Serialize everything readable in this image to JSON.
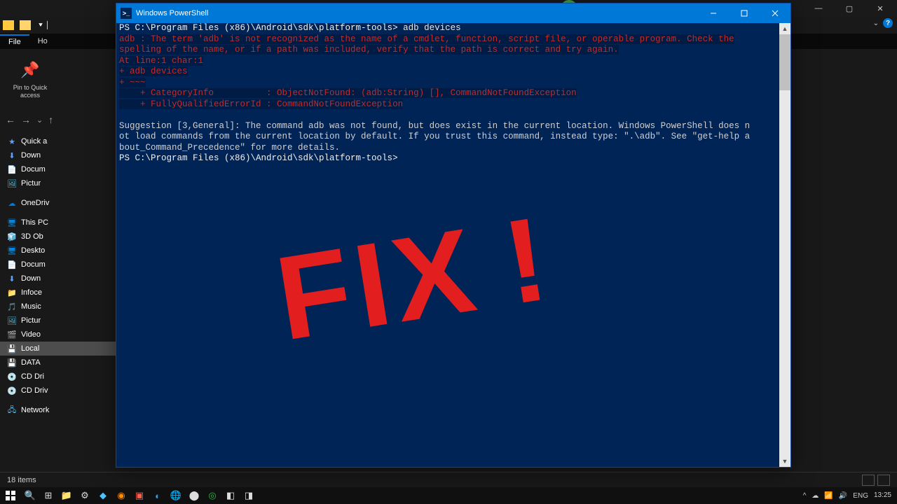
{
  "explorer": {
    "file_tab": "File",
    "home_tab": "Ho",
    "quick_access_label": "Pin to Quick access",
    "nav": {
      "back": "←",
      "forward": "→",
      "up": "↑"
    },
    "sidebar": [
      {
        "icon": "★",
        "cls": "star",
        "label": "Quick a"
      },
      {
        "icon": "⬇",
        "cls": "dl",
        "label": "Down"
      },
      {
        "icon": "📄",
        "cls": "doc",
        "label": "Docum"
      },
      {
        "icon": "🖼",
        "cls": "pic",
        "label": "Pictur"
      },
      {
        "icon": "☁",
        "cls": "od",
        "label": "OneDriv"
      },
      {
        "icon": "🖥",
        "cls": "pc",
        "label": "This PC"
      },
      {
        "icon": "🧊",
        "cls": "pc",
        "label": "3D Ob"
      },
      {
        "icon": "🖥",
        "cls": "pc",
        "label": "Deskto"
      },
      {
        "icon": "📄",
        "cls": "doc",
        "label": "Docum"
      },
      {
        "icon": "⬇",
        "cls": "dl",
        "label": "Down"
      },
      {
        "icon": "📁",
        "cls": "doc",
        "label": "Infoce"
      },
      {
        "icon": "🎵",
        "cls": "pic",
        "label": "Music"
      },
      {
        "icon": "🖼",
        "cls": "pic",
        "label": "Pictur"
      },
      {
        "icon": "🎬",
        "cls": "pic",
        "label": "Video"
      },
      {
        "icon": "💾",
        "cls": "drv",
        "label": "Local",
        "selected": true
      },
      {
        "icon": "💾",
        "cls": "drv",
        "label": "DATA"
      },
      {
        "icon": "💿",
        "cls": "disk",
        "label": "CD Dri"
      },
      {
        "icon": "💿",
        "cls": "disk",
        "label": "CD Driv"
      },
      {
        "icon": "🖧",
        "cls": "net",
        "label": "Network"
      }
    ],
    "status_text": "18 items"
  },
  "powershell": {
    "title": "Windows PowerShell",
    "prompt_path": "PS C:\\Program Files (x86)\\Android\\sdk\\platform-tools>",
    "command": "adb devices",
    "error_lines": [
      "adb : The term 'adb' is not recognized as the name of a cmdlet, function, script file, or operable program. Check the",
      "spelling of the name, or if a path was included, verify that the path is correct and try again.",
      "At line:1 char:1",
      "+ adb devices",
      "+ ~~~",
      "    + CategoryInfo          : ObjectNotFound: (adb:String) [], CommandNotFoundException",
      "    + FullyQualifiedErrorId : CommandNotFoundException"
    ],
    "suggestion_lines": [
      "Suggestion [3,General]: The command adb was not found, but does exist in the current location. Windows PowerShell does n",
      "ot load commands from the current location by default. If you trust this command, instead type: \".\\adb\". See \"get-help a",
      "bout_Command_Precedence\" for more details."
    ],
    "second_prompt": "PS C:\\Program Files (x86)\\Android\\sdk\\platform-tools>"
  },
  "overlay": {
    "fix_text": "FIX",
    "mark": "!"
  },
  "taskbar": {
    "tray": {
      "chevron": "^",
      "cloud": "☁",
      "wifi": "📶",
      "vol": "🔊",
      "lang": "ENG",
      "time": "13:25"
    }
  }
}
